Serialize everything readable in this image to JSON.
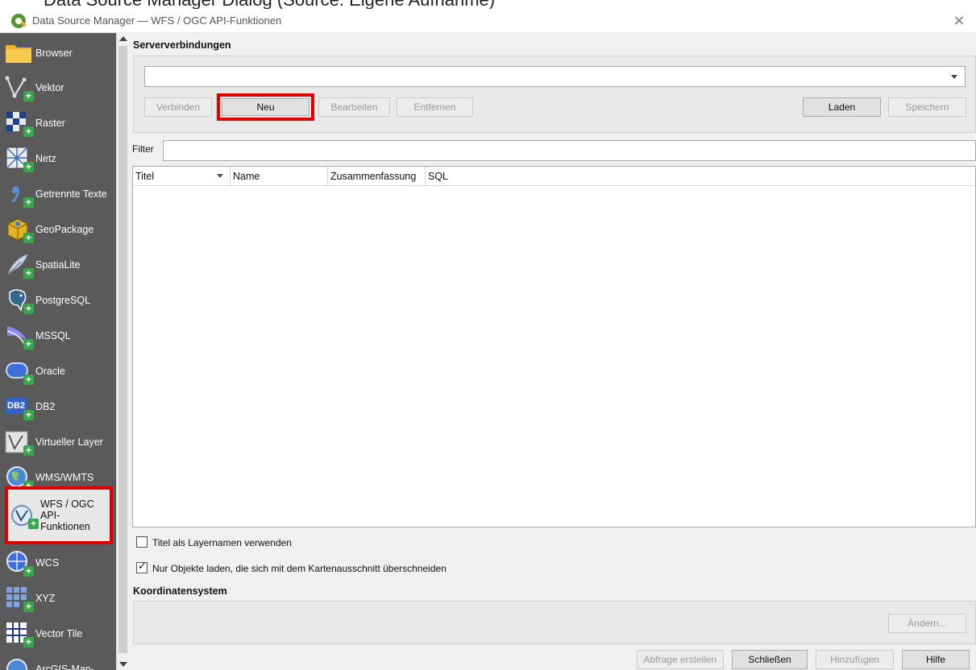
{
  "caption": "Data Source Manager Dialog (Source: Eigene Aufnahme)",
  "window": {
    "title": "Data Source Manager — WFS / OGC API-Funktionen",
    "close_icon": "×"
  },
  "sidebar": {
    "items": [
      {
        "label": "Browser",
        "icon": "folder-icon"
      },
      {
        "label": "Vektor",
        "icon": "vector-icon"
      },
      {
        "label": "Raster",
        "icon": "raster-icon"
      },
      {
        "label": "Netz",
        "icon": "mesh-icon"
      },
      {
        "label": "Getrennte Texte",
        "icon": "delimited-text-icon"
      },
      {
        "label": "GeoPackage",
        "icon": "geopackage-icon"
      },
      {
        "label": "SpatiaLite",
        "icon": "spatialite-icon"
      },
      {
        "label": "PostgreSQL",
        "icon": "postgresql-icon"
      },
      {
        "label": "MSSQL",
        "icon": "mssql-icon"
      },
      {
        "label": "Oracle",
        "icon": "oracle-icon"
      },
      {
        "label": "DB2",
        "icon": "db2-icon"
      },
      {
        "label": "Virtueller Layer",
        "icon": "virtual-layer-icon"
      },
      {
        "label": "WMS/WMTS",
        "icon": "wms-icon"
      },
      {
        "label": "WFS / OGC API-Funktionen",
        "icon": "wfs-icon"
      },
      {
        "label": "WCS",
        "icon": "wcs-icon"
      },
      {
        "label": "XYZ",
        "icon": "xyz-icon"
      },
      {
        "label": "Vector Tile",
        "icon": "vector-tile-icon"
      },
      {
        "label": "ArcGIS-Map-",
        "icon": "arcgis-icon"
      }
    ],
    "selected": "WFS / OGC API-Funktionen",
    "db2_badge": "DB2"
  },
  "server": {
    "group_title": "Serververbindungen",
    "combo_value": "",
    "buttons": {
      "connect": "Verbinden",
      "new": "Neu",
      "edit": "Bearbeiten",
      "remove": "Entfernen",
      "load": "Laden",
      "save": "Speichern"
    }
  },
  "filter": {
    "label": "Filter",
    "value": ""
  },
  "table": {
    "columns": [
      "Titel",
      "Name",
      "Zusammenfassung",
      "SQL"
    ],
    "rows": []
  },
  "options": {
    "use_title_as_layername": {
      "label": "Titel als Layernamen verwenden",
      "checked": false
    },
    "only_intersecting": {
      "label": "Nur Objekte laden, die sich mit dem Kartenausschnitt überschneiden",
      "checked": true
    }
  },
  "crs": {
    "group_title": "Koordinatensystem",
    "change_button": "Ändern..."
  },
  "footer": {
    "build_query": "Abfrage erstellen",
    "close": "Schließen",
    "add": "Hinzufügen",
    "help": "Hilfe"
  },
  "colors": {
    "sidebar_bg": "#5a5a5a",
    "highlight": "#e00000",
    "plus_badge": "#3aa54a"
  }
}
